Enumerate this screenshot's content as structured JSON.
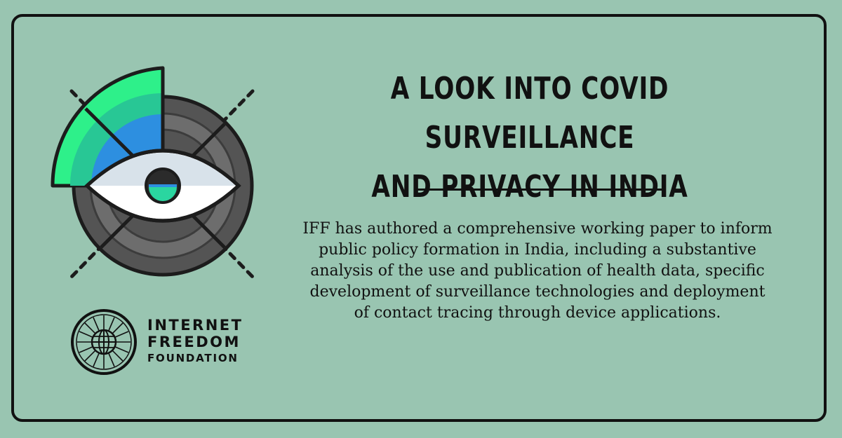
{
  "title": {
    "line1": "A LOOK INTO COVID SURVEILLANCE",
    "line2": "AND PRIVACY IN INDIA"
  },
  "description": {
    "lines": [
      "IFF has authored a comprehensive working paper to inform",
      "public policy formation in India, including a substantive",
      "analysis of the use and publication of health data, specific",
      "development of surveillance technologies and deployment",
      "of contact tracing through device applications."
    ]
  },
  "logo": {
    "line1": "INTERNET",
    "line2": "FREEDOM",
    "line3": "FOUNDATION"
  },
  "icons": {
    "illustration": "surveillance-eye-radar-icon",
    "logo_mark": "iff-chakra-globe-icon"
  },
  "colors": {
    "background": "#99c5b1",
    "border": "#111111",
    "radar_green": "#2ef08a",
    "radar_teal": "#28c795",
    "radar_blue": "#2d8fe0",
    "disc_dark": "#545454",
    "disc_mid": "#6d6d6d",
    "eye_top": "#d8e2ea",
    "eye_white": "#ffffff"
  }
}
